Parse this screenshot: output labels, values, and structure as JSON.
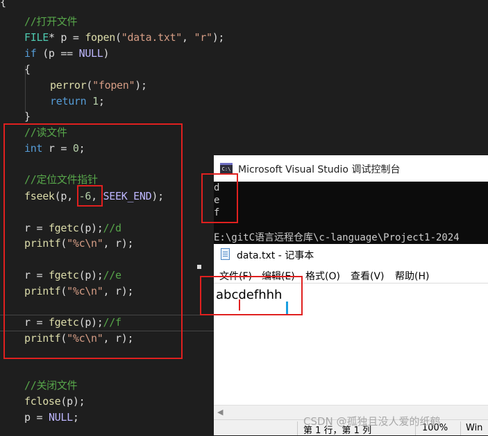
{
  "editor": {
    "open_brace": "{",
    "comment_open": "//打开文件",
    "line_fopen": {
      "type": "FILE",
      "rest1": "* p = ",
      "fn": "fopen",
      "args_open": "(",
      "str1": "\"data.txt\"",
      "comma": ", ",
      "str2": "\"r\"",
      "end": ");"
    },
    "line_if": {
      "kw": "if",
      "rest1": " (p == ",
      "macro": "NULL",
      "end": ")"
    },
    "brace_open": "{",
    "line_perror": {
      "fn": "perror",
      "open": "(",
      "str": "\"fopen\"",
      "end": ");"
    },
    "line_return": {
      "kw": "return",
      "num": " 1",
      "end": ";"
    },
    "brace_close": "}",
    "comment_read": "//读文件",
    "line_int": {
      "kw": "int",
      "rest": " r = ",
      "num": "0",
      "end": ";"
    },
    "comment_seek": "//定位文件指针",
    "line_fseek": {
      "fn": "fseek",
      "open": "(p, ",
      "num": "-6",
      "comma": ", ",
      "macro": "SEEK_END",
      "end": ");"
    },
    "line_fgetc": {
      "pre": "r = ",
      "fn": "fgetc",
      "args": "(p);"
    },
    "comment_d": "//d",
    "comment_e": "//e",
    "comment_f": "//f",
    "line_printf": {
      "fn": "printf",
      "open": "(",
      "str": "\"%c\\n\"",
      "rest": ", r);"
    },
    "comment_close": "//关闭文件",
    "line_fclose": {
      "fn": "fclose",
      "args": "(p);"
    },
    "line_null": {
      "pre": "p = ",
      "macro": "NULL",
      "end": ";"
    }
  },
  "console": {
    "title": "Microsoft Visual Studio 调试控制台",
    "icon_text": "C:\\",
    "output": [
      "d",
      "e",
      "f"
    ],
    "path_line": "E:\\gitC语言远程仓库\\c-language\\Project1-2024"
  },
  "notepad": {
    "title": "data.txt - 记事本",
    "menu": [
      "文件(F)",
      "编辑(E)",
      "格式(O)",
      "查看(V)",
      "帮助(H)"
    ],
    "content": "abcdefhhh",
    "status": {
      "position": "第 1 行，第 1 列",
      "zoom": "100%",
      "encoding": "Win"
    }
  },
  "watermark": "CSDN @孤独且没人爱的纸鹤",
  "colors": {
    "editor_bg": "#1e1e1e",
    "comment": "#57a64a",
    "keyword": "#569cd6",
    "string": "#d69d85",
    "macro": "#beb7ff",
    "annotation_red": "#e0201f",
    "caret_blue": "#1a9fe0"
  }
}
